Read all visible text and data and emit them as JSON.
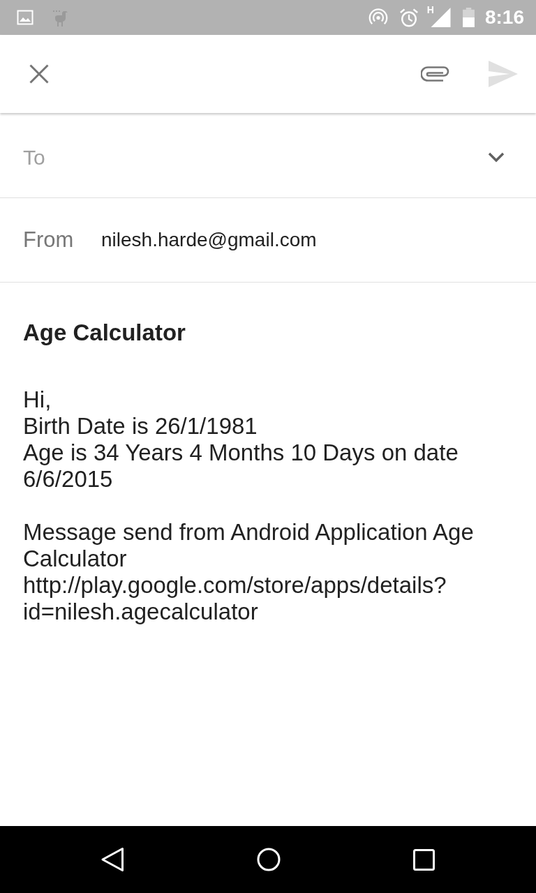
{
  "status_bar": {
    "network": "H",
    "time": "8:16"
  },
  "toolbar": {
    "send_disabled": true
  },
  "to_field": {
    "label": "To"
  },
  "from_field": {
    "label": "From",
    "value": "nilesh.harde@gmail.com"
  },
  "subject": {
    "value": "Age Calculator"
  },
  "body": {
    "paragraphs": [
      {
        "lines": [
          "Hi,",
          "Birth Date is 26/1/1981",
          "Age is 34 Years 4 Months 10 Days on date 6/6/2015"
        ]
      },
      {
        "lines": [
          "Message send from Android Application Age Calculator",
          "http://play.google.com/store/apps/details?id=nilesh.agecalculator"
        ]
      }
    ]
  }
}
